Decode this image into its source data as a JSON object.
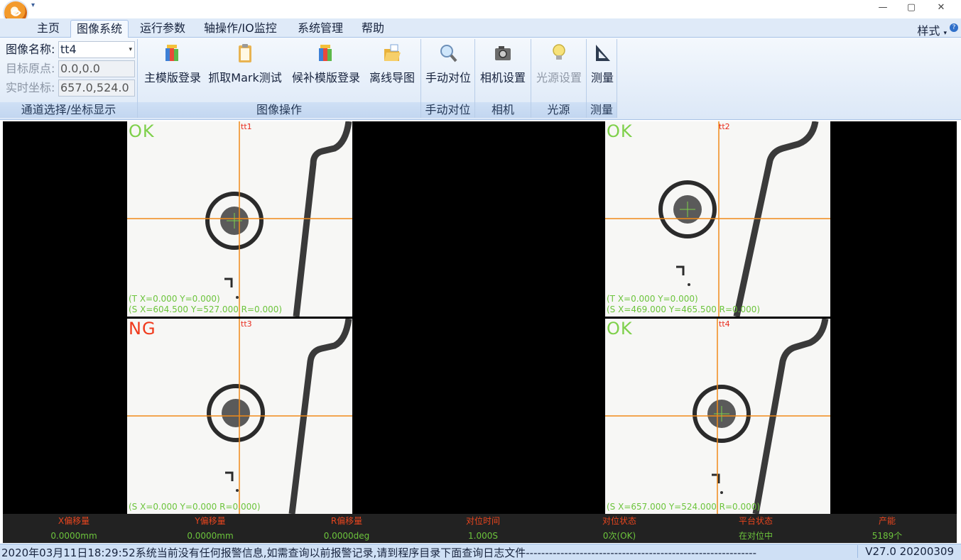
{
  "tabs": [
    {
      "label": "主页",
      "active": false
    },
    {
      "label": "图像系统",
      "active": true
    },
    {
      "label": "运行参数",
      "active": false
    },
    {
      "label": "轴操作/IO监控",
      "active": false
    },
    {
      "label": "系统管理",
      "active": false
    },
    {
      "label": "帮助",
      "active": false
    }
  ],
  "style_menu": "样式",
  "window_controls": {
    "minimize": "—",
    "restore": "▢",
    "close": "✕"
  },
  "channel_group": {
    "image_name_label": "图像名称:",
    "image_name_value": "tt4",
    "origin_label": "目标原点:",
    "origin_value": "0.0,0.0",
    "realtime_label": "实时坐标:",
    "realtime_value": "657.0,524.0",
    "group_label": "通道选择/坐标显示"
  },
  "image_ops": {
    "main_template_login": "主模版登录",
    "grab_mark_test": "抓取Mark测试",
    "candidate_template_login": "候补模版登录",
    "offline_import": "离线导图",
    "group_label": "图像操作"
  },
  "manual_align": {
    "button": "手动对位",
    "group_label": "手动对位"
  },
  "camera": {
    "button": "相机设置",
    "group_label": "相机"
  },
  "light": {
    "button": "光源设置",
    "group_label": "光源"
  },
  "measure": {
    "button": "测量",
    "group_label": "测量"
  },
  "cameras": [
    {
      "id": "tt1",
      "status": "OK",
      "line1": "(T X=0.000 Y=0.000)",
      "line2": "(S X=604.500 Y=527.000 R=0.000)"
    },
    {
      "id": "tt2",
      "status": "OK",
      "line1": "(T X=0.000 Y=0.000)",
      "line2": "(S X=469.000 Y=465.500 R=0.000)"
    },
    {
      "id": "tt3",
      "status": "NG",
      "line1": "",
      "line2": "(S X=0.000 Y=0.000 R=0.000)"
    },
    {
      "id": "tt4",
      "status": "OK",
      "line1": "",
      "line2": "(S X=657.000 Y=524.000 R=0.000)"
    }
  ],
  "info_bar": {
    "headers": [
      "X偏移量",
      "Y偏移量",
      "R偏移量",
      "对位时间",
      "对位状态",
      "平台状态",
      "产能"
    ],
    "values": [
      "0.0000mm",
      "0.0000mm",
      "0.0000deg",
      "1.000S",
      "0次(OK)",
      "在对位中",
      "5189个"
    ]
  },
  "status_bar": {
    "message": "2020年03月11日18:29:52系统当前没有任何报警信息,如需查询以前报警记录,请到程序目录下面查询日志文件------------------------------------------------------------",
    "version": "V27.0  20200309"
  },
  "colors": {
    "ok": "#7ed04a",
    "ng": "#f03a1c",
    "crosshair": "#f08a1a",
    "info_header": "#e8451e",
    "info_value": "#6cc43c"
  }
}
